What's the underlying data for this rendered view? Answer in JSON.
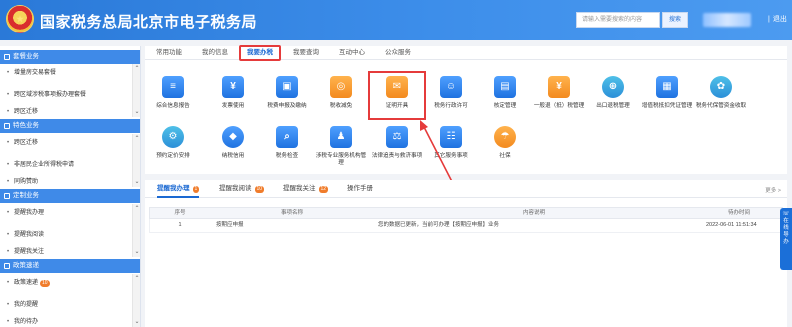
{
  "header": {
    "title": "国家税务总局北京市电子税务局",
    "search_placeholder": "请输入需要搜索的内容",
    "search_button": "搜索",
    "exit_label": "退出"
  },
  "sidebar": {
    "sections": [
      {
        "title": "套餐业务",
        "items": [
          "增量房交易套餐",
          "跨区域涉税事项报办理套餐",
          "跨区迁移"
        ]
      },
      {
        "title": "特色业务",
        "items": [
          "跨区迁移",
          "非居民企业所得税申请",
          "同购赞助"
        ]
      },
      {
        "title": "定制业务",
        "items": [
          "提醒我办理",
          "提醒我阅读",
          "提醒我关注"
        ]
      },
      {
        "title": "政策速递",
        "items": [
          "政策速递",
          "我的提醒",
          "我的待办"
        ],
        "badge": "10"
      }
    ]
  },
  "main": {
    "tabs": [
      "常用功能",
      "我的信息",
      "我要办税",
      "我要查询",
      "互动中心",
      "公众服务"
    ],
    "active_tab": "我要办税",
    "apps_row1": [
      {
        "label": "综合信息报告",
        "icon": "document-list-icon"
      },
      {
        "label": "发票使用",
        "icon": "invoice-icon"
      },
      {
        "label": "税费申报及缴纳",
        "icon": "tax-payment-icon"
      },
      {
        "label": "税收减免",
        "icon": "tax-reduction-icon"
      },
      {
        "label": "证明开具",
        "icon": "certificate-icon"
      },
      {
        "label": "税务行政许可",
        "icon": "person-badge-icon"
      },
      {
        "label": "核定管理",
        "icon": "clipboard-icon"
      },
      {
        "label": "一般退（抵）税管理",
        "icon": "refund-icon"
      },
      {
        "label": "出口退税管理",
        "icon": "globe-icon"
      },
      {
        "label": "增值税抵扣凭证管理",
        "icon": "receipt-icon"
      },
      {
        "label": "税务代保管资金收取",
        "icon": "safe-icon"
      }
    ],
    "apps_row2": [
      {
        "label": "预约定价安排",
        "icon": "gear-check-icon"
      },
      {
        "label": "纳税信用",
        "icon": "diamond-icon"
      },
      {
        "label": "税务检查",
        "icon": "inspection-icon"
      },
      {
        "label": "涉税专业服务机构管理",
        "icon": "institution-icon"
      },
      {
        "label": "法律追责与救济事项",
        "icon": "gavel-icon"
      },
      {
        "label": "其它服务事项",
        "icon": "other-service-icon"
      },
      {
        "label": "社保",
        "icon": "social-security-icon"
      }
    ]
  },
  "panel": {
    "tabs": [
      {
        "label": "提醒我办理",
        "count": "1"
      },
      {
        "label": "提醒我阅读",
        "count": "10"
      },
      {
        "label": "提醒我关注",
        "count": "12"
      },
      {
        "label": "操作手册",
        "count": ""
      }
    ],
    "more_label": "更多 >",
    "columns": [
      "序号",
      "事项名称",
      "内容说明",
      "待办时间"
    ],
    "rows": [
      {
        "no": "1",
        "name": "按期应申报",
        "desc": "您的数据已更新，当前可办理【按期应申报】业务",
        "time": "2022-06-01 11:51:34"
      }
    ]
  },
  "float_help": "在线导办"
}
